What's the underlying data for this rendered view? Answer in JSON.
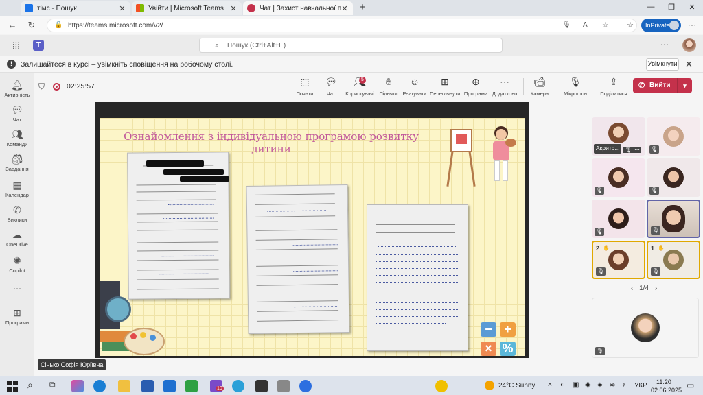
{
  "browser": {
    "tabs": [
      {
        "title": "тімс - Пошук"
      },
      {
        "title": "Увійти | Microsoft Teams"
      },
      {
        "title": "Чат | Захист навчальної пра"
      }
    ],
    "url": "https://teams.microsoft.com/v2/",
    "inprivate_label": "InPrivate"
  },
  "teams": {
    "search_placeholder": "Пошук (Ctrl+Alt+E)",
    "notification": {
      "message": "Залишайтеся в курсі – увімкніть сповіщення на робочому столі.",
      "button": "Увімкнути"
    },
    "rail": [
      {
        "label": "Активність",
        "icon": "bell-icon"
      },
      {
        "label": "Чат",
        "icon": "chat-icon"
      },
      {
        "label": "Команди",
        "icon": "teams-icon"
      },
      {
        "label": "Завдання",
        "icon": "assignments-icon"
      },
      {
        "label": "Календар",
        "icon": "calendar-icon"
      },
      {
        "label": "Виклики",
        "icon": "phone-icon"
      },
      {
        "label": "OneDrive",
        "icon": "cloud-icon"
      },
      {
        "label": "Copilot",
        "icon": "copilot-icon"
      },
      {
        "label": "Програми",
        "icon": "apps-icon"
      }
    ]
  },
  "meeting": {
    "timer": "02:25:57",
    "toolbar": {
      "start": "Почати",
      "chat": "Чат",
      "people": "Користувачі",
      "people_count": "5",
      "raise": "Підняти",
      "react": "Реагувати",
      "view": "Переглянути",
      "apps": "Програми",
      "more": "Додатково",
      "camera": "Камера",
      "mic": "Мікрофон",
      "share": "Поділитися",
      "leave": "Вийти"
    },
    "slide_title": "Ознайомлення з індивідуальною програмою розвитку дитини",
    "presenter": "Сінько Софія Юріївна",
    "participants": [
      {
        "name": "Акрито..."
      },
      {
        "name": ""
      },
      {
        "name": ""
      },
      {
        "name": ""
      },
      {
        "name": ""
      },
      {
        "name": ""
      },
      {
        "name": "",
        "hand": "2"
      },
      {
        "name": "",
        "hand": "1"
      },
      {
        "name": ""
      }
    ],
    "pager": "1/4"
  },
  "taskbar": {
    "weather": "24°C Sunny",
    "lang": "УКР",
    "time": "11:20",
    "date": "02.06.2025",
    "teams_badge": "10"
  }
}
